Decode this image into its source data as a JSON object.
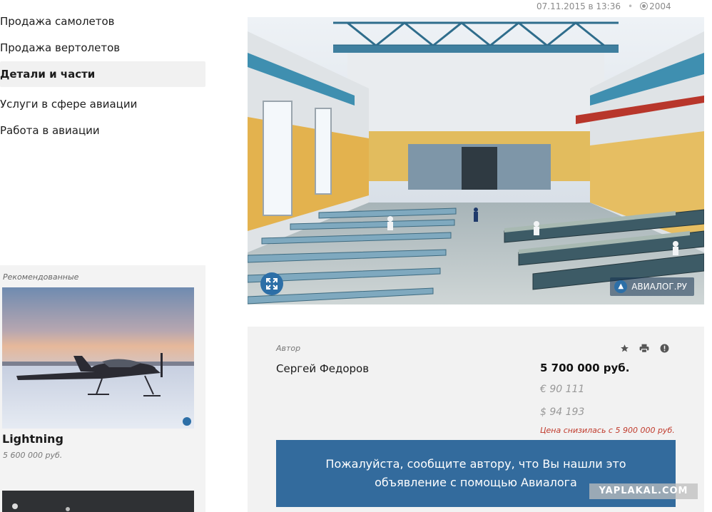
{
  "nav": {
    "items": [
      {
        "label": "Продажа самолетов",
        "active": false
      },
      {
        "label": "Продажа вертолетов",
        "active": false
      },
      {
        "label": "Детали и части",
        "active": true
      },
      {
        "label": "Услуги в сфере авиации",
        "active": false
      },
      {
        "label": "Работа в авиации",
        "active": false
      }
    ]
  },
  "recommended": {
    "heading": "Рекомендованные",
    "items": [
      {
        "title": "Lightning",
        "price": "5 600 000 руб."
      }
    ]
  },
  "meta": {
    "date": "07.11.2015 в 13:36",
    "views": "2004"
  },
  "hero": {
    "watermark": "АВИАЛОГ.РУ"
  },
  "listing": {
    "author_label": "Автор",
    "author_name": "Сергей Федоров",
    "price_rub": "5 700 000 руб.",
    "price_eur": "€ 90 111",
    "price_usd": "$ 94 193",
    "price_drop": "Цена снизилась с 5 900 000 руб.",
    "notice": "Пожалуйста, сообщите автору, что Вы нашли это объявление с помощью Авиалога"
  },
  "overlay": {
    "site": "YAPLAKAL.COM"
  },
  "colors": {
    "accent": "#336b9d",
    "price_drop": "#c0392b",
    "panel_bg": "#f2f2f2"
  }
}
